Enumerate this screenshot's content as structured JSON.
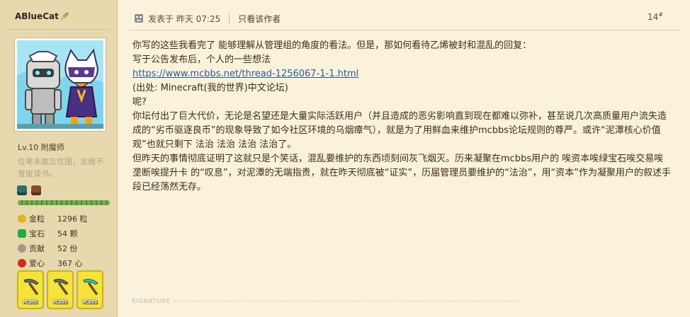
{
  "user": {
    "name": "ABlueCat",
    "level": "Lv.10 附魔师",
    "motto": "位卑未敢忘忧国，志微不曾废读书。",
    "xp_fraction": 1.0,
    "stats": [
      {
        "label": "金粒",
        "value": "1296 粒",
        "icon": "gold-nugget-icon",
        "color": "#e3b420"
      },
      {
        "label": "宝石",
        "value": "54 颗",
        "icon": "emerald-icon",
        "color": "#26a845"
      },
      {
        "label": "贡献",
        "value": "52 份",
        "icon": "contribution-icon",
        "color": "#a89a82"
      },
      {
        "label": "爱心",
        "value": "367 心",
        "icon": "heart-icon",
        "color": "#d42a20"
      }
    ],
    "medals": [
      {
        "icon": "medal-helmet-icon",
        "color": "#2e6f6c"
      },
      {
        "icon": "medal-helmet-icon",
        "color": "#8a4a2c"
      }
    ],
    "badges": [
      {
        "label": "MCBBS",
        "icon": "iron-pickaxe-icon",
        "color": "#6f6f6f"
      },
      {
        "label": "MCBBS",
        "icon": "iron-pickaxe-icon",
        "color": "#6f6f6f"
      },
      {
        "label": "MCBBS",
        "icon": "diamond-pickaxe-icon",
        "color": "#38c7c1"
      }
    ]
  },
  "post": {
    "posted": "发表于 昨天 07:25",
    "only_author": "只看该作者",
    "floor": "14",
    "floor_sup": "#",
    "lines": [
      "你写的这些我看完了 能够理解从管理组的角度的看法。但是，那如何看待乙烯被封和混乱的回复：",
      "写于公告发布后，个人的一些想法"
    ],
    "link": "https://www.mcbbs.net/thread-1256067-1-1.html",
    "source": "(出处: Minecraft(我的世界)中文论坛)",
    "question": "呢?",
    "paragraph1": "你坛付出了巨大代价，无论是名望还是大量实际活跃用户（并且造成的恶劣影响直到现在都难以弥补，甚至说几次高质量用户流失造成的“劣币驱逐良币”的现象导致了如今社区环境的乌烟瘴气），就是为了用鲜血来维护mcbbs论坛规则的尊严。或许“泥潭核心价值观”也就只剩下 法治 法治 法治 法治了。",
    "paragraph2": "但昨天的事情彻底证明了这就只是个笑话，混乱要维护的东西顷刻间灰飞烟灭。历来凝聚在mcbbs用户的 唉资本唉绿宝石唉交易唉垄断唉提升卡 的“叹息”，对泥潭的无端指责，就在昨天彻底被“证实”，历届管理员要维护的“法治”，用“资本”作为凝聚用户的叙述手段已经荡然无存。",
    "signature_label": "SIGNATURE"
  }
}
